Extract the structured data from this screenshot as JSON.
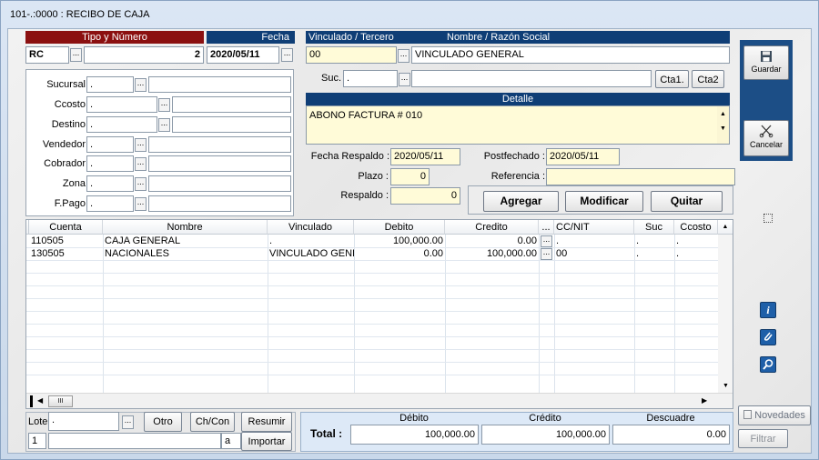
{
  "window": {
    "title": "101-.:0000 : RECIBO DE CAJA"
  },
  "header": {
    "tipo_numero_label": "Tipo y Número",
    "tipo": "RC",
    "numero": "2",
    "fecha_label": "Fecha",
    "fecha": "2020/05/11",
    "vinculado_label": "Vinculado / Tercero",
    "nombre_label": "Nombre / Razón Social",
    "vinculado": "00",
    "nombre": "VINCULADO GENERAL",
    "suc_label": "Suc.",
    "suc_value": ".",
    "cta1": "Cta1.",
    "cta2": "Cta2"
  },
  "left_fields": [
    {
      "label": "Sucursal",
      "value": "."
    },
    {
      "label": "Ccosto",
      "value": "."
    },
    {
      "label": "Destino",
      "value": "."
    },
    {
      "label": "Vendedor",
      "value": "."
    },
    {
      "label": "Cobrador",
      "value": "."
    },
    {
      "label": "Zona",
      "value": "."
    },
    {
      "label": "F.Pago",
      "value": "."
    }
  ],
  "detalle": {
    "label": "Detalle",
    "text": "ABONO FACTURA # 010"
  },
  "dates": {
    "fecha_respaldo_label": "Fecha Respaldo :",
    "fecha_respaldo": "2020/05/11",
    "postfechado_label": "Postfechado :",
    "postfechado": "2020/05/11",
    "plazo_label": "Plazo :",
    "plazo": "0",
    "referencia_label": "Referencia :",
    "referencia": "",
    "respaldo_label": "Respaldo :",
    "respaldo": "0"
  },
  "actions": {
    "agregar": "Agregar",
    "modificar": "Modificar",
    "quitar": "Quitar"
  },
  "toolbar": {
    "guardar": "Guardar",
    "cancelar": "Cancelar",
    "novedades": "Novedades",
    "filtrar": "Filtrar"
  },
  "grid": {
    "columns": [
      "Cuenta",
      "Nombre",
      "Vinculado",
      "Debito",
      "Credito",
      "...",
      "CC/NIT",
      "Suc",
      "Ccosto"
    ],
    "rows": [
      {
        "cuenta": "110505",
        "nombre": "CAJA GENERAL",
        "vinculado": ".",
        "debito": "100,000.00",
        "credito": "0.00",
        "ccnit": ".",
        "suc": ".",
        "ccosto": "."
      },
      {
        "cuenta": "130505",
        "nombre": "NACIONALES",
        "vinculado": "VINCULADO GENE",
        "debito": "0.00",
        "credito": "100,000.00",
        "ccnit": "00",
        "suc": ".",
        "ccosto": "."
      }
    ],
    "hscroll_thumb": "III"
  },
  "bottom": {
    "lote_label": "Lote",
    "lote_value": ".",
    "otro": "Otro",
    "chcon": "Ch/Con",
    "resumir": "Resumir",
    "importar": "Importar",
    "page_num": "1",
    "a_label": "a"
  },
  "totals": {
    "total_label": "Total :",
    "debito_label": "Débito",
    "credito_label": "Crédito",
    "descuadre_label": "Descuadre",
    "debito": "100,000.00",
    "credito": "100,000.00",
    "descuadre": "0.00"
  }
}
